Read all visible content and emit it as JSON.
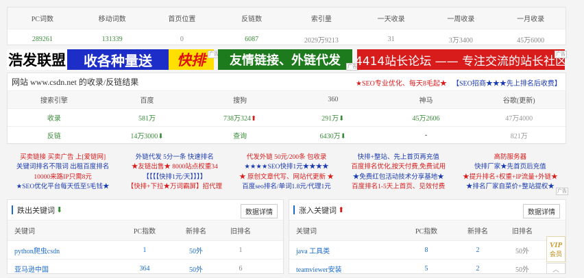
{
  "stats": {
    "headers": [
      "PC词数",
      "移动词数",
      "首页位置",
      "反链数",
      "索引量",
      "一天收录",
      "一周收录",
      "一月收录"
    ],
    "values": [
      "289261",
      "131339",
      "0",
      "6087",
      "2029万9213",
      "31",
      "3万3400",
      "45万6000"
    ]
  },
  "banners": {
    "b1": "浩发联盟",
    "b2": "收各种量送",
    "b3": "快排",
    "b4": "友情链接、外链代发",
    "b5": "4414站长论坛 —— 专注交流的站长社区",
    "ad_tag": "广告"
  },
  "seo": {
    "title": "网站 www.csdn.net 的收录/反链结果",
    "promo1": "★SEO专业优化、每天8毛起★",
    "promo2": "【SEO招商★★★先上排名后收费】",
    "headers": [
      "搜索引擎",
      "百度",
      "搜狗",
      "360",
      "神马",
      "谷歌(更新)"
    ],
    "row1": {
      "label": "收录",
      "baidu": "581万",
      "sogou": "738万324",
      "s360": "291万",
      "shenma": "45万2606",
      "google": "47万4000"
    },
    "row2": {
      "label": "反链",
      "baidu": "14万3000",
      "sogou": "查询",
      "s360": "6430万",
      "shenma": "-",
      "google": "821万"
    }
  },
  "ads": [
    [
      "买卖链接 买卖广告 上[爱链网]",
      "关键词排名不限词 出租百度排名",
      "10000来路IP只需8元",
      "★SEO优化平台每天低至5毛钱★"
    ],
    [
      "外链代发 5分一条 快速排名",
      "★友链出售★ 8000站点权重34",
      "【【【【快排1元/天】】】】",
      "【快排+下拉★万词霸屏】招代理"
    ],
    [
      "代发外链 50元/200条 包收录",
      "★★★★SEO快排1元★★★★",
      "★ 原创文章代写、网站代更新 ★",
      "百度seo排名/单词1.8元/代理1元"
    ],
    [
      "快排+整站、先上首页再充值",
      "百度排名优化,按天付费,免费试用",
      "★免费红包活动技术分享基地★",
      "百度排名1-5天上首页、见效付费"
    ],
    [
      "高防服务器",
      "快排厂家★先首页后充值",
      "★提升排名+权重+IP流量+外链★",
      "★排名厂家自菜价+整站提权★"
    ]
  ],
  "left_kw": {
    "title": "跌出关键词",
    "button": "数据详情",
    "headers": [
      "关键词",
      "PC指数",
      "新排名",
      "旧排名"
    ],
    "rows": [
      [
        "python爬虫csdn",
        "1",
        "50外",
        "1"
      ],
      [
        "亚马逊中国",
        "364",
        "50外",
        "6"
      ]
    ]
  },
  "right_kw": {
    "title": "涨入关键词",
    "button": "数据详情",
    "headers": [
      "关键词",
      "PC指数",
      "新排名",
      "旧排名"
    ],
    "rows": [
      [
        "java 工具类",
        "8",
        "2",
        "50外"
      ],
      [
        "teamviewer安装",
        "5",
        "2",
        "50外"
      ]
    ]
  },
  "vip": {
    "v": "VIP",
    "label": "会员"
  }
}
